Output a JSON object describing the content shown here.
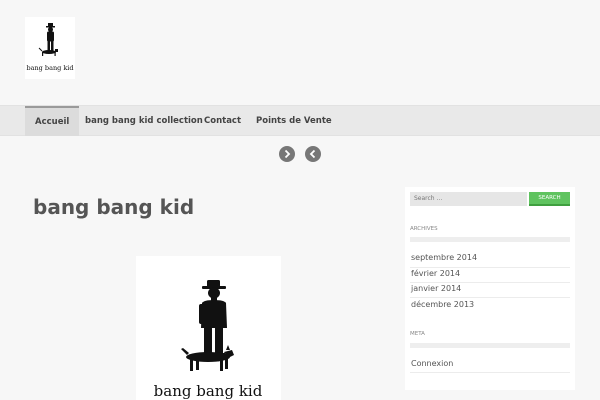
{
  "site": {
    "logo_text": "bang bang kid"
  },
  "nav": {
    "items": [
      {
        "label": "Accueil",
        "active": true
      },
      {
        "label": "bang bang kid collection",
        "active": false
      },
      {
        "label": "Contact",
        "active": false
      },
      {
        "label": "Points de Vente",
        "active": false
      }
    ]
  },
  "slider": {
    "next_icon": "chevron-right-icon",
    "prev_icon": "chevron-left-icon"
  },
  "main": {
    "title": "bang bang kid",
    "image_caption": "bang bang kid"
  },
  "sidebar": {
    "search_placeholder": "Search ...",
    "search_button": "SEARCH",
    "archives_title": "ARCHIVES",
    "archives": [
      "septembre 2014",
      "février 2014",
      "janvier 2014",
      "décembre 2013"
    ],
    "meta_title": "META",
    "meta_links": [
      "Connexion"
    ]
  },
  "colors": {
    "accent": "#5fc35f",
    "nav_bg": "#e9e9e9",
    "page_bg": "#f7f7f7"
  }
}
